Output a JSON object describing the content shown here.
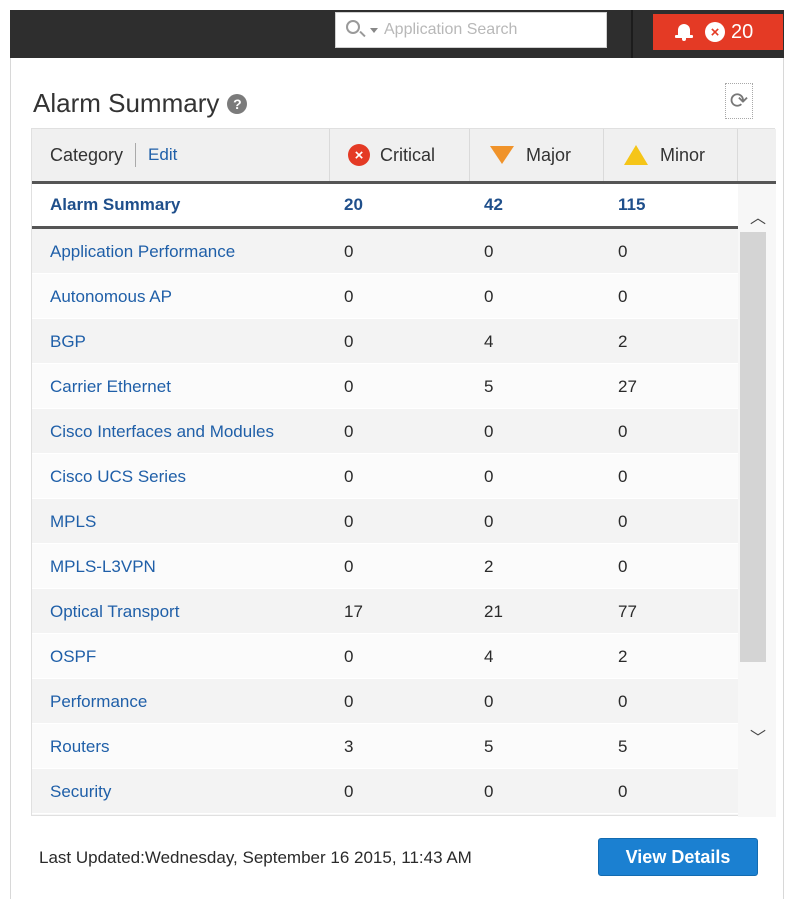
{
  "header": {
    "search_placeholder": "Application Search",
    "alarm_count": "20"
  },
  "panel": {
    "title": "Alarm Summary",
    "help_glyph": "?"
  },
  "table": {
    "columns": {
      "category": "Category",
      "edit": "Edit",
      "critical": "Critical",
      "major": "Major",
      "minor": "Minor"
    },
    "summary": {
      "label": "Alarm Summary",
      "critical": "20",
      "major": "42",
      "minor": "115"
    },
    "rows": [
      {
        "category": "Application Performance",
        "critical": "0",
        "major": "0",
        "minor": "0"
      },
      {
        "category": "Autonomous AP",
        "critical": "0",
        "major": "0",
        "minor": "0"
      },
      {
        "category": "BGP",
        "critical": "0",
        "major": "4",
        "minor": "2"
      },
      {
        "category": "Carrier Ethernet",
        "critical": "0",
        "major": "5",
        "minor": "27"
      },
      {
        "category": "Cisco Interfaces and Modules",
        "critical": "0",
        "major": "0",
        "minor": "0"
      },
      {
        "category": "Cisco UCS Series",
        "critical": "0",
        "major": "0",
        "minor": "0"
      },
      {
        "category": "MPLS",
        "critical": "0",
        "major": "0",
        "minor": "0"
      },
      {
        "category": "MPLS-L3VPN",
        "critical": "0",
        "major": "2",
        "minor": "0"
      },
      {
        "category": "Optical Transport",
        "critical": "17",
        "major": "21",
        "minor": "77"
      },
      {
        "category": "OSPF",
        "critical": "0",
        "major": "4",
        "minor": "2"
      },
      {
        "category": "Performance",
        "critical": "0",
        "major": "0",
        "minor": "0"
      },
      {
        "category": "Routers",
        "critical": "3",
        "major": "5",
        "minor": "5"
      },
      {
        "category": "Security",
        "critical": "0",
        "major": "0",
        "minor": "0"
      }
    ]
  },
  "footer": {
    "last_updated": "Last Updated:Wednesday, September 16 2015, 11:43 AM",
    "view_details": "View Details"
  },
  "colors": {
    "critical": "#e43a25",
    "major": "#f0932a",
    "minor": "#f5c518",
    "link": "#1f5fa8",
    "button": "#1b80d1"
  },
  "icons": [
    "search-icon",
    "bell-icon",
    "critical-x-icon",
    "help-icon",
    "refresh-icon",
    "chevron-up-icon",
    "chevron-down-icon"
  ]
}
